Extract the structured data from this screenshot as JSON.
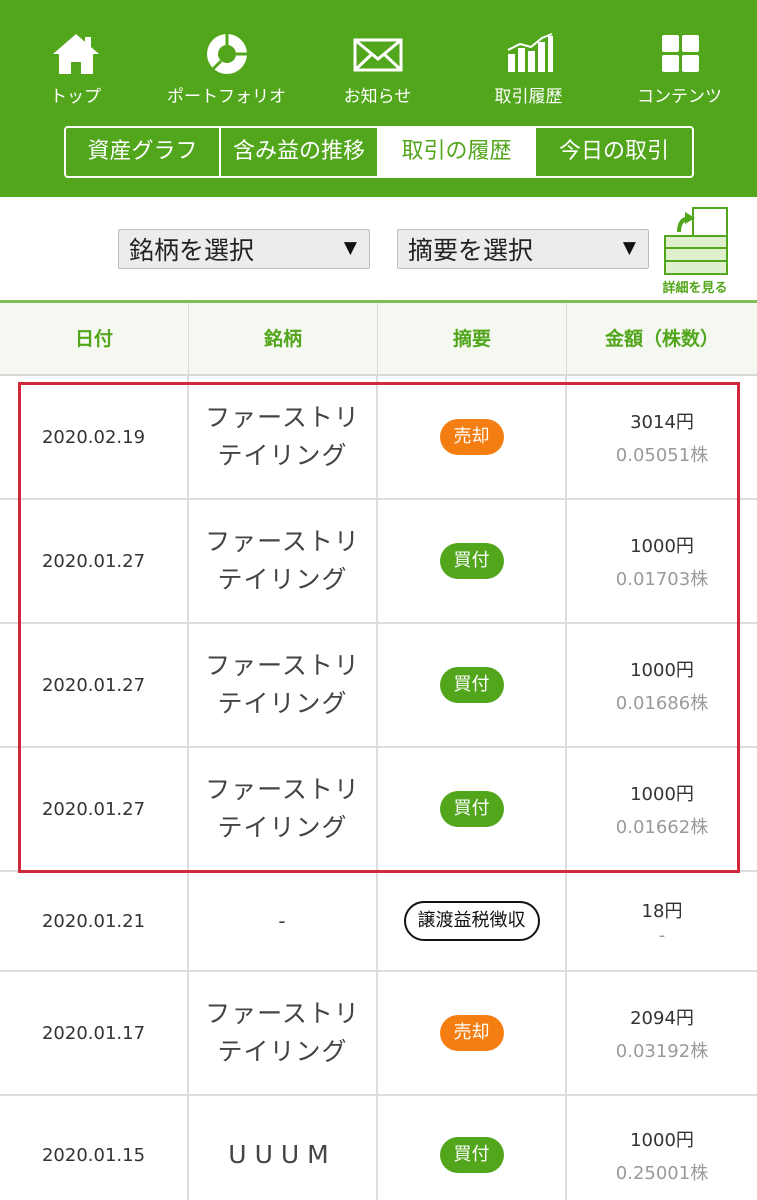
{
  "nav": [
    {
      "label": "トップ",
      "icon": "home-icon"
    },
    {
      "label": "ポートフォリオ",
      "icon": "pie-chart-icon"
    },
    {
      "label": "お知らせ",
      "icon": "envelope-icon"
    },
    {
      "label": "取引履歴",
      "icon": "bar-chart-icon"
    },
    {
      "label": "コンテンツ",
      "icon": "grid-icon"
    }
  ],
  "tabs": [
    {
      "label": "資産グラフ",
      "active": false
    },
    {
      "label": "含み益の推移",
      "active": false
    },
    {
      "label": "取引の履歴",
      "active": true
    },
    {
      "label": "今日の取引",
      "active": false
    }
  ],
  "filters": {
    "stock_select": "銘柄を選択",
    "summary_select": "摘要を選択",
    "caret": "▼",
    "detail_label": "詳細を見る"
  },
  "table": {
    "headers": [
      "日付",
      "銘柄",
      "摘要",
      "金額（株数）"
    ],
    "rows": [
      {
        "date": "2020.02.19",
        "name_line1": "ファーストリ",
        "name_line2": "テイリング",
        "type": "売却",
        "kind": "sell",
        "amount": "3014円",
        "shares": "0.05051株"
      },
      {
        "date": "2020.01.27",
        "name_line1": "ファーストリ",
        "name_line2": "テイリング",
        "type": "買付",
        "kind": "buy",
        "amount": "1000円",
        "shares": "0.01703株"
      },
      {
        "date": "2020.01.27",
        "name_line1": "ファーストリ",
        "name_line2": "テイリング",
        "type": "買付",
        "kind": "buy",
        "amount": "1000円",
        "shares": "0.01686株"
      },
      {
        "date": "2020.01.27",
        "name_line1": "ファーストリ",
        "name_line2": "テイリング",
        "type": "買付",
        "kind": "buy",
        "amount": "1000円",
        "shares": "0.01662株"
      },
      {
        "date": "2020.01.21",
        "name_line1": "-",
        "name_line2": "",
        "type": "譲渡益税徴収",
        "kind": "tax",
        "amount": "18円",
        "shares": "-"
      },
      {
        "date": "2020.01.17",
        "name_line1": "ファーストリ",
        "name_line2": "テイリング",
        "type": "売却",
        "kind": "sell",
        "amount": "2094円",
        "shares": "0.03192株"
      },
      {
        "date": "2020.01.15",
        "name_line1": "UUUM",
        "name_line2": "",
        "type": "買付",
        "kind": "buy",
        "amount": "1000円",
        "shares": "0.25001株"
      }
    ]
  },
  "colors": {
    "brand_green": "#52a61c",
    "sell_orange": "#f47e12",
    "highlight_red": "#d0273a"
  }
}
